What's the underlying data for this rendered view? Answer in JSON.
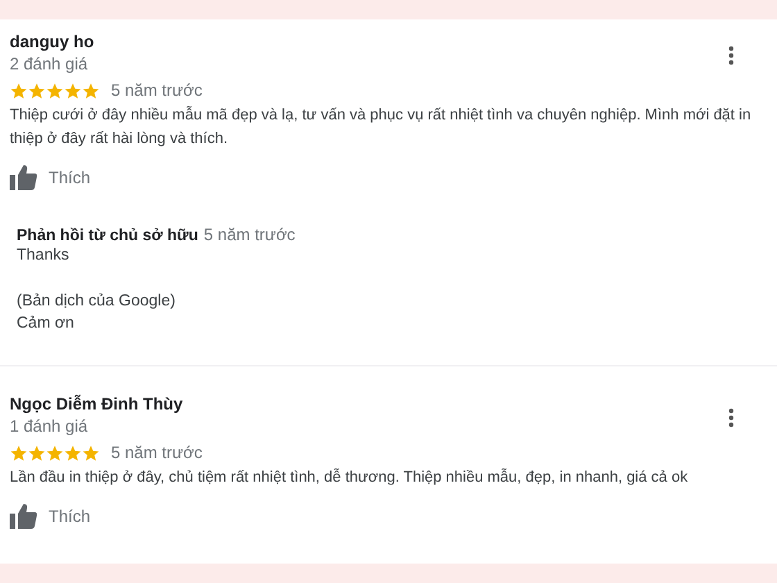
{
  "reviews": [
    {
      "author": "danguy ho",
      "review_count": "2 đánh giá",
      "stars": 5,
      "time": "5 năm trước",
      "text": "Thiệp cưới ở đây nhiều mẫu mã đẹp và lạ, tư vấn và phục vụ rất nhiệt tình va chuyên nghiệp. Mình mới đặt in thiệp ở đây rất hài lòng và thích.",
      "like": "Thích",
      "owner_reply": {
        "title": "Phản hồi từ chủ sở hữu",
        "time": "5 năm trước",
        "text": "Thanks",
        "translation_lines": [
          "(Bản dịch của Google)",
          "Cảm ơn"
        ]
      }
    },
    {
      "author": "Ngọc Diễm Đinh Thùy",
      "review_count": "1 đánh giá",
      "stars": 5,
      "time": "5 năm trước",
      "text": "Lần đầu in thiệp ở đây, chủ tiệm rất nhiệt tình, dễ thương. Thiệp nhiều mẫu, đẹp, in nhanh, giá cả ok",
      "like": "Thích"
    }
  ]
}
